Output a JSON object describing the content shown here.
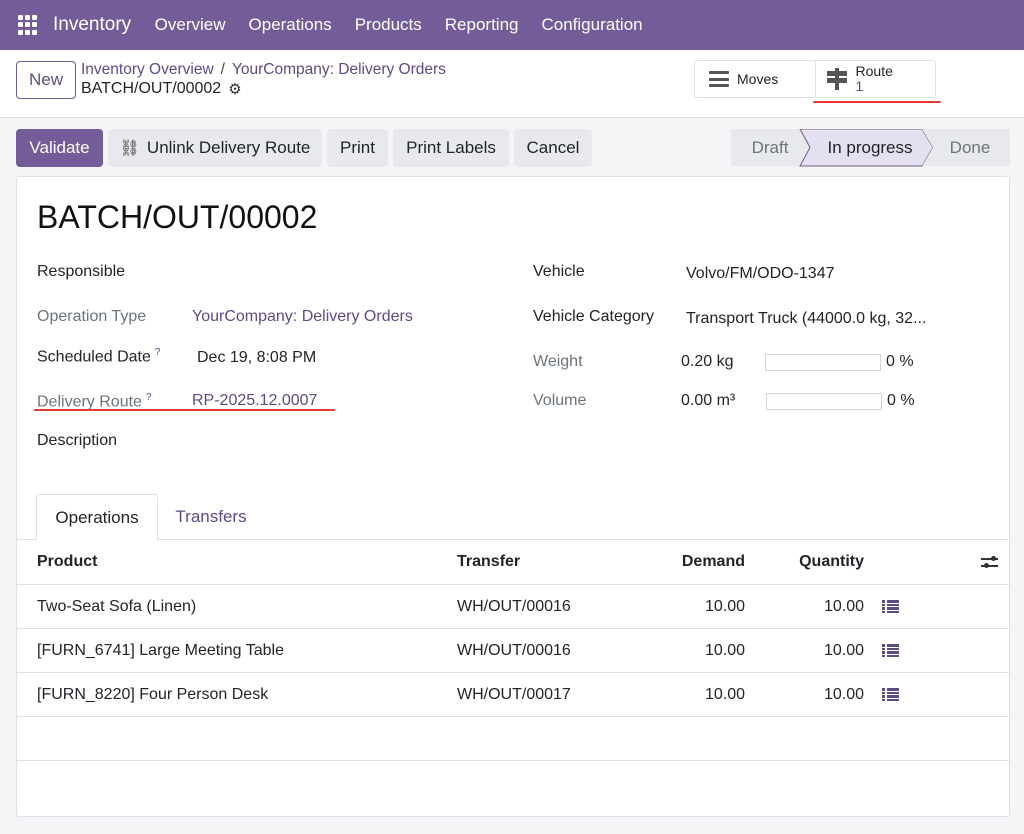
{
  "navbar": {
    "app_name": "Inventory",
    "menu": [
      "Overview",
      "Operations",
      "Products",
      "Reporting",
      "Configuration"
    ]
  },
  "control": {
    "new_label": "New",
    "breadcrumb": [
      "Inventory Overview",
      "YourCompany: Delivery Orders"
    ],
    "record_name": "BATCH/OUT/00002",
    "moves_label": "Moves",
    "route_label": "Route",
    "route_count": "1"
  },
  "actions": {
    "validate": "Validate",
    "unlink": "Unlink Delivery Route",
    "print": "Print",
    "print_labels": "Print Labels",
    "cancel": "Cancel"
  },
  "status": {
    "stages": [
      "Draft",
      "In progress",
      "Done"
    ],
    "current": "In progress"
  },
  "form": {
    "title": "BATCH/OUT/00002",
    "responsible_label": "Responsible",
    "operation_type_label": "Operation Type",
    "operation_type_value": "YourCompany: Delivery Orders",
    "scheduled_date_label": "Scheduled Date",
    "scheduled_date_value": "Dec 19, 8:08 PM",
    "delivery_route_label": "Delivery Route",
    "delivery_route_value": "RP-2025.12.0007",
    "description_label": "Description",
    "help_mark": "?",
    "vehicle_label": "Vehicle",
    "vehicle_value": "Volvo/FM/ODO-1347",
    "vehicle_category_label": "Vehicle Category",
    "vehicle_category_value": "Transport Truck (44000.0 kg, 32...",
    "weight_label": "Weight",
    "weight_value": "0.20 kg",
    "weight_percent": "0 %",
    "volume_label": "Volume",
    "volume_value": "0.00 m³",
    "volume_percent": "0 %"
  },
  "tabs": [
    "Operations",
    "Transfers"
  ],
  "table": {
    "headers": [
      "Product",
      "Transfer",
      "Demand",
      "Quantity"
    ],
    "rows": [
      {
        "product": "Two-Seat Sofa (Linen)",
        "transfer": "WH/OUT/00016",
        "demand": "10.00",
        "quantity": "10.00"
      },
      {
        "product": "[FURN_6741] Large Meeting Table",
        "transfer": "WH/OUT/00016",
        "demand": "10.00",
        "quantity": "10.00"
      },
      {
        "product": "[FURN_8220] Four Person Desk",
        "transfer": "WH/OUT/00017",
        "demand": "10.00",
        "quantity": "10.00"
      }
    ]
  },
  "colors": {
    "brand": "#735c97",
    "link": "#5f4b84",
    "annotation": "#e53935"
  }
}
